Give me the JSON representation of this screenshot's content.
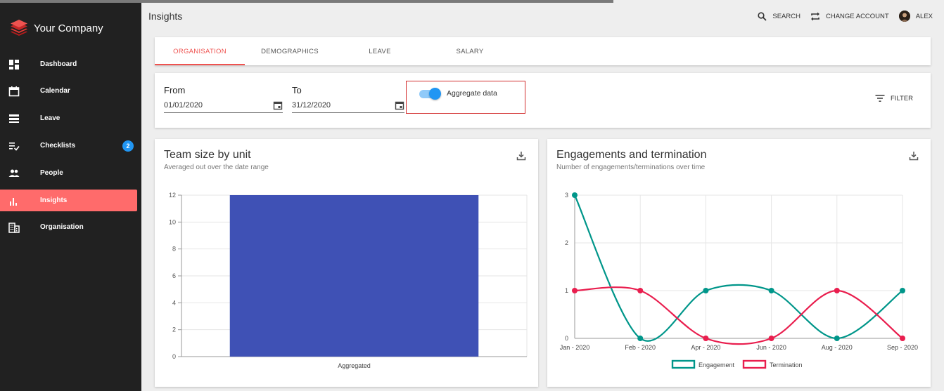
{
  "app": {
    "company": "Your Company",
    "page_title": "Insights"
  },
  "sidebar": {
    "items": [
      {
        "label": "Dashboard",
        "icon": "dashboard-icon"
      },
      {
        "label": "Calendar",
        "icon": "calendar-icon"
      },
      {
        "label": "Leave",
        "icon": "leave-icon"
      },
      {
        "label": "Checklists",
        "icon": "checklist-icon",
        "badge": "2"
      },
      {
        "label": "People",
        "icon": "people-icon"
      },
      {
        "label": "Insights",
        "icon": "insights-icon",
        "active": true
      },
      {
        "label": "Organisation",
        "icon": "organisation-icon"
      }
    ]
  },
  "header": {
    "search": "SEARCH",
    "change_account": "CHANGE ACCOUNT",
    "user": "ALEX"
  },
  "tabs": [
    {
      "label": "ORGANISATION",
      "active": true
    },
    {
      "label": "DEMOGRAPHICS"
    },
    {
      "label": "LEAVE"
    },
    {
      "label": "SALARY"
    }
  ],
  "filters": {
    "from_label": "From",
    "from_value": "01/01/2020",
    "to_label": "To",
    "to_value": "31/12/2020",
    "aggregate_label": "Aggregate data",
    "aggregate_on": true,
    "filter_button": "FILTER"
  },
  "colors": {
    "accent": "#ef5350",
    "sidebar_active": "#ff6b6b",
    "bar": "#3f51b5",
    "engagement": "#00968a",
    "termination": "#e91e4e",
    "toggle": "#2196f3"
  },
  "chart_data": [
    {
      "type": "bar",
      "title": "Team size by unit",
      "subtitle": "Averaged out over the date range",
      "categories": [
        "Aggregated"
      ],
      "values": [
        12
      ],
      "ylim": [
        0,
        12
      ],
      "yticks": [
        0,
        2,
        4,
        6,
        8,
        10,
        12
      ],
      "grid": true
    },
    {
      "type": "line",
      "title": "Engagements and termination",
      "subtitle": "Number of engagements/terminations over time",
      "x": [
        "Jan - 2020",
        "Feb - 2020",
        "Apr - 2020",
        "Jun - 2020",
        "Aug - 2020",
        "Sep - 2020"
      ],
      "series": [
        {
          "name": "Engagement",
          "values": [
            3,
            0,
            1,
            1,
            0,
            1
          ]
        },
        {
          "name": "Termination",
          "values": [
            1,
            1,
            0,
            0,
            1,
            0
          ]
        }
      ],
      "ylim": [
        0,
        3
      ],
      "yticks": [
        0,
        1,
        2,
        3
      ],
      "legend": "bottom",
      "grid": true
    }
  ]
}
